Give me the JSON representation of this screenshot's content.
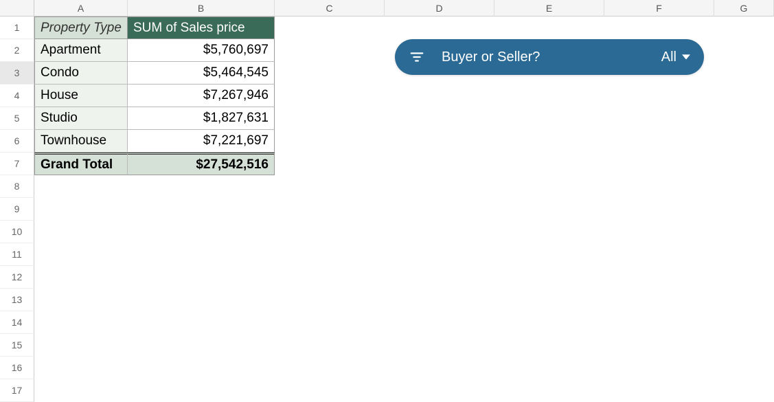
{
  "columns": [
    "A",
    "B",
    "C",
    "D",
    "E",
    "F",
    "G"
  ],
  "rowCount": 17,
  "selectedRow": 3,
  "pivot": {
    "header_a": "Property Type",
    "header_b": "SUM of Sales price",
    "rows": [
      {
        "label": "Apartment",
        "value": "$5,760,697"
      },
      {
        "label": "Condo",
        "value": "$5,464,545"
      },
      {
        "label": "House",
        "value": "$7,267,946"
      },
      {
        "label": "Studio",
        "value": "$1,827,631"
      },
      {
        "label": "Townhouse",
        "value": "$7,221,697"
      }
    ],
    "total_label": "Grand Total",
    "total_value": "$27,542,516"
  },
  "slicer": {
    "label": "Buyer or Seller?",
    "value": "All"
  }
}
